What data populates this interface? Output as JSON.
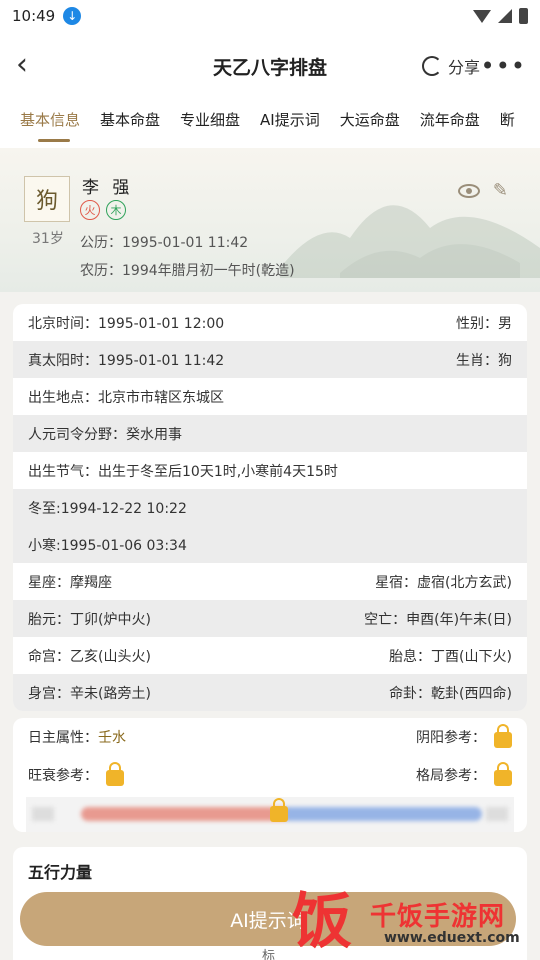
{
  "status": {
    "time": "10:49"
  },
  "appbar": {
    "title": "天乙八字排盘",
    "share_label": "分享",
    "more": "•••"
  },
  "tabs": [
    "基本信息",
    "基本命盘",
    "专业细盘",
    "AI提示词",
    "大运命盘",
    "流年命盘",
    "断"
  ],
  "profile": {
    "avatar_text": "狗",
    "name": "李 强",
    "age": "31岁",
    "elements": [
      "火",
      "木"
    ],
    "solar_label": "公历：",
    "solar": "1995-01-01 11:42",
    "lunar_label": "农历：",
    "lunar": "1994年腊月初一午时(乾造)"
  },
  "rows": [
    {
      "l": "北京时间：1995-01-01 12:00",
      "r": "性别：男",
      "alt": false
    },
    {
      "l": "真太阳时：1995-01-01 11:42",
      "r": "生肖：狗",
      "alt": true
    },
    {
      "l": "出生地点：北京市市辖区东城区",
      "r": "",
      "alt": false
    },
    {
      "l": "人元司令分野：癸水用事",
      "r": "",
      "alt": true
    },
    {
      "l": "出生节气：出生于冬至后10天1时,小寒前4天15时",
      "r": "",
      "alt": false
    },
    {
      "l": "冬至:1994-12-22 10:22",
      "r": "",
      "alt": true
    },
    {
      "l": "小寒:1995-01-06 03:34",
      "r": "",
      "alt": true
    },
    {
      "l": "星座：摩羯座",
      "r": "星宿：虚宿(北方玄武)",
      "alt": false
    },
    {
      "l": "胎元：丁卯(炉中火)",
      "r": "空亡：申酉(年)午未(日)",
      "alt": true
    },
    {
      "l": "命宫：乙亥(山头火)",
      "r": "胎息：丁酉(山下火)",
      "alt": false
    },
    {
      "l": "身宫：辛未(路旁土)",
      "r": "命卦：乾卦(西四命)",
      "alt": true
    }
  ],
  "attrs": {
    "rizhu_label": "日主属性：",
    "rizhu_value": "壬水",
    "yinyang_label": "阴阳参考：",
    "wangshuai_label": "旺衰参考：",
    "geju_label": "格局参考："
  },
  "wuxing": {
    "title": "五行力量",
    "peek": "标"
  },
  "ai_button": "AI提示词",
  "watermark": {
    "big": "饭",
    "text": "千饭手游网",
    "url": "www.eduext.com"
  }
}
